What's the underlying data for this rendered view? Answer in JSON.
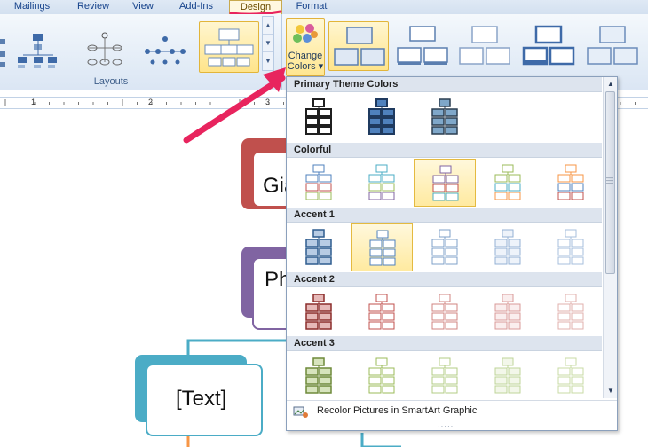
{
  "tabs": [
    "Mailings",
    "Review",
    "View",
    "Add-Ins",
    "Design",
    "Format"
  ],
  "active_tab": "Design",
  "ribbon": {
    "layouts_group_label": "Layouts",
    "change_colors": {
      "line1": "Change",
      "line2": "Colors",
      "caret": "▾"
    },
    "scroll_up": "▲",
    "scroll_down": "▼",
    "scroll_more": "▼"
  },
  "ruler": {
    "numbers": [
      "1",
      "2",
      "3"
    ]
  },
  "document": {
    "shape1_text": "Gia",
    "shape2_text": "Ph",
    "shape3_text": "[Text]"
  },
  "dropdown": {
    "sections": [
      {
        "label": "Primary Theme Colors"
      },
      {
        "label": "Colorful"
      },
      {
        "label": "Accent 1"
      },
      {
        "label": "Accent 2"
      },
      {
        "label": "Accent 3"
      }
    ],
    "recolor_label": "Recolor Pictures in SmartArt Graphic",
    "scroll_up": "▲",
    "scroll_down": "▼",
    "resize_grip": "·····"
  },
  "colors": {
    "annotation": "#e8245e",
    "accent1": "#4f81bd",
    "accent2": "#c0504d",
    "accent3": "#9bbb59",
    "accent4": "#8064a2",
    "accent5": "#4bacc6",
    "accent6": "#f79646",
    "dark": "#1f1f1f"
  }
}
